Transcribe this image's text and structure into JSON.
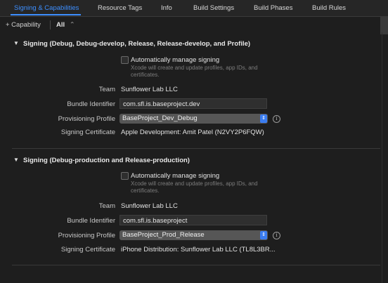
{
  "tabs": [
    {
      "label": "Signing & Capabilities",
      "active": true
    },
    {
      "label": "Resource Tags"
    },
    {
      "label": "Info"
    },
    {
      "label": "Build Settings"
    },
    {
      "label": "Build Phases"
    },
    {
      "label": "Build Rules"
    }
  ],
  "toolbar": {
    "add_capability": "+ Capability",
    "filter_value": "All",
    "filter_arrow": "⌃"
  },
  "colors": {
    "accent": "#3d8fff",
    "background": "#1e1e1e",
    "popup_arrow": "#3a7cf0"
  },
  "sections": [
    {
      "title": "Signing (Debug, Debug-develop, Release, Release-develop, and Profile)",
      "auto_manage_label": "Automatically manage signing",
      "auto_manage_checked": false,
      "auto_manage_help": "Xcode will create and update profiles, app IDs, and certificates.",
      "team_label": "Team",
      "team_value": "Sunflower Lab LLC",
      "bundle_label": "Bundle Identifier",
      "bundle_value": "com.sfl.is.baseproject.dev",
      "profile_label": "Provisioning Profile",
      "profile_value": "BaseProject_Dev_Debug",
      "cert_label": "Signing Certificate",
      "cert_value": "Apple Development: Amit Patel (N2VY2P6FQW)"
    },
    {
      "title": "Signing (Debug-production and Release-production)",
      "auto_manage_label": "Automatically manage signing",
      "auto_manage_checked": false,
      "auto_manage_help": "Xcode will create and update profiles, app IDs, and certificates.",
      "team_label": "Team",
      "team_value": "Sunflower Lab LLC",
      "bundle_label": "Bundle Identifier",
      "bundle_value": "com.sfl.is.baseproject",
      "profile_label": "Provisioning Profile",
      "profile_value": "BaseProject_Prod_Release",
      "cert_label": "Signing Certificate",
      "cert_value": "iPhone Distribution: Sunflower Lab LLC (TL8L3BR..."
    }
  ],
  "icons": {
    "disclosure": "▼",
    "info": "i",
    "popup_arrows": "⇕"
  }
}
